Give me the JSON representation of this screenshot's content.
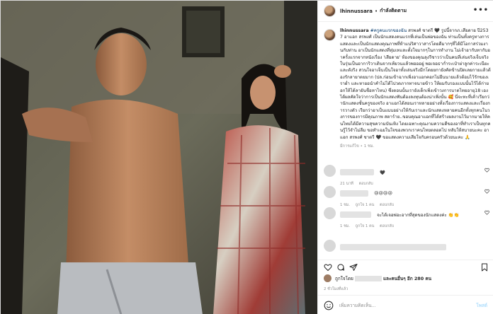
{
  "post": {
    "username": "lhinnussara",
    "follow_label": "กำลังติดตาม",
    "more_label": "•••",
    "caption_hashtag": "#ครูคนแรกของฉัน",
    "caption_text": " สรพงศ์ ชาตรี 🖤 รูปนี้จากภ.เสียดาย ปี2537 อาแอก สรพงศ์ เป็นนักแสดงคนแรกที่เล่นเป็นพ่อของฉัน ท่านเป็นทั้งครูทางการแสดงและเป็นนักแสดงคุณภาพที่ห้าแน่ริศาวาสารโดยดีมากๆที่ได้มีโอกาสร่วมงานกับท่าน อาเป็นนักแสดงที่ทุ่มเทและตั้งใจมากๆในการทำงาน ไม่เจ้าอากับทากับอาครั้งแรกจากหนังเรื่อง 'เสียดาย' ห้องของคุณลุงรีชาวว่าเป็นคนที่เล่นจริงเจ็บจริง ในรุ่นเป็นอาการิวาเดินจากเท้ยวนแล้วพอออยู่ พอเจอธาก่ำระเป๋าผ่าลูกค่าระเนียะ และตังริง สวนใจอาเจ็บเป็นใจอาทั้งเล่นจริงมีกโดยยกายังคัดข้านปิดเลยกายแล้วต้องรักลายาดยมาก (ปล.ก่อนเข้าฉากเพิ่งอาแอกคอกไม่ยืนนายแล้วต้อมไว้รักของเราผ่ำ และหายอนำคำไม่ได้ไปวดภากทาจนายข้าว ให้ผมรับรองแบบนั้นไว้ได้ก่ายอกให้ได้ลายันชื่อหาไหน) ซึ่งตอนนั้นเรายังเด็กเพิ่งเข้าวงการบาดไทยอายุ18 เอง ได้ผลคัดใจว่าการเป็นนักแสดงฟันต้องลงทุนต้องน่าเพิ่งนั้น 🥰 นี่จะทะที่เค้าเรียกว่านักแสดงชั้นครูของจริง อาแอกได้สอนเราหลายอย่างทั้งเรื่องการแสดงและเรื่องการวางตัว เรียกว่าอาเป็นแบบอย่างให้กับเราและนักแสดงหลายคนอีกทั้งทุกคนในวงการของการมีคุณภาพ สตาร์าย..ขอบคุณอาแอกที่ได้สร้างผลงานไว้มากมายให้คนไทยได้มีความสุขความบันเทิง ไดยเฉพาะคุณงามความดีของอาที่ทำเราเป็นทุกคนรู้ไว้จำไม่ลืม ขอทำเฉยในใจของพวกเราคนไทยตลอดไป หลับให้สบายนะคะ อาแอก สรพงศ์ ชาตรี 🖤 ขอแสดงความเสียใจกับครอบครัวด้วยนะคะ 🙏",
    "caption_time": "มีการแก้ไข • 1 ชม.",
    "comments": [
      {
        "text": "🖤",
        "time": "21 นาที",
        "reply": "ตอบกลับ",
        "likes": ""
      },
      {
        "text": "😢😢😢😢",
        "time": "1 ชม.",
        "likes": "ถูกใจ 1 คน",
        "reply": "ตอบกลับ"
      },
      {
        "text": "จะได้เจอพ่อะอากที่สุดของนักแสดงค่ะ 👏👏",
        "time": "1 ชม.",
        "likes": "ถูกใจ 1 คน",
        "reply": "ตอบกลับ"
      }
    ],
    "likes_prefix": "ถูกใจโดย",
    "likes_suffix": "และคนอื่นๆ อีก 280 คน",
    "date_label": "2 ชั่วโมงที่แล้ว",
    "add_comment_placeholder": "เพิ่มความคิดเห็น...",
    "post_button": "โพสต์"
  }
}
